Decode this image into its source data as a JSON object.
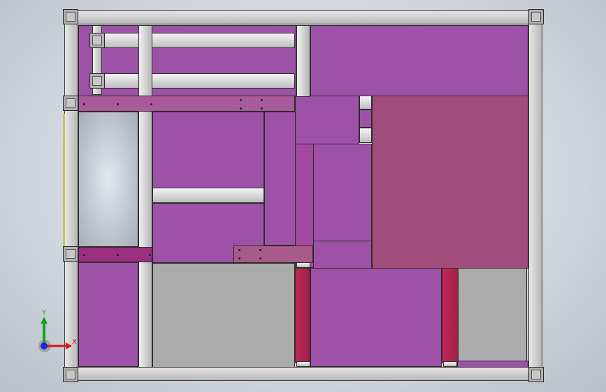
{
  "colors": {
    "purple": "#9d52a7",
    "rose": "#a04d7b",
    "magenta_bar": "#9e2e80",
    "crimson": "#b02450",
    "grey_panel": "#ababab",
    "frame_grey": "#cfcfcf"
  },
  "triad": {
    "y_label": "Y",
    "x_label": "X",
    "icon": "coordinate-triad-icon"
  }
}
